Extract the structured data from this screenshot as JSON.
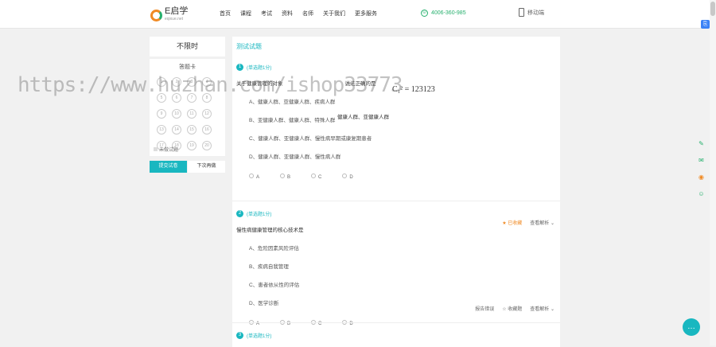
{
  "header": {
    "logo_text": "E启学",
    "logo_sub": "eqixue.net",
    "nav": [
      "首页",
      "课程",
      "考试",
      "资料",
      "名师",
      "关于我们",
      "更多服务"
    ],
    "phone": "4006-360-985",
    "mobile": "移动端"
  },
  "sidebar": {
    "timer": "不限时",
    "card_title": "答题卡",
    "numbers": [
      "1",
      "2",
      "3",
      "4",
      "5",
      "6",
      "7",
      "8",
      "9",
      "10",
      "11",
      "12",
      "13",
      "14",
      "15",
      "16",
      "17",
      "18",
      "19",
      "20"
    ],
    "legend": "未做试题",
    "submit": "提交试卷",
    "next": "下次再做"
  },
  "main": {
    "title": "测试试题",
    "questions": [
      {
        "num": "1",
        "type": "(单选题1分)",
        "stem": "关于健康管理的对象",
        "stem_extra": "说法正确的是",
        "formula": "C₁² = 123123",
        "options": [
          "A、健康人群、亚健康人群、疾病人群",
          "B、亚健康人群、健康人群、特殊人群",
          "C、健康人群、亚健康人群、慢性病早期或康复期患者",
          "D、健康人群、亚健康人群、慢性病人群"
        ],
        "float_text": "健康人群、亚健康人群",
        "answers": [
          "A",
          "B",
          "C",
          "D"
        ],
        "fav": "已收藏",
        "view": "查看解析"
      },
      {
        "num": "2",
        "type": "(单选题1分)",
        "stem": "慢性病健康管理的核心技术是",
        "options": [
          "A、危险因素风险评估",
          "B、疾病自我管理",
          "C、患者依从性的评估",
          "D、医学诊断"
        ],
        "answers": [
          "A",
          "B",
          "C",
          "D"
        ],
        "report": "报告错误",
        "fav": "收藏题",
        "view": "查看解析"
      },
      {
        "num": "3",
        "type": "(单选题1分)"
      }
    ]
  },
  "watermark": "https://www.huzhan.com/ishop33773"
}
